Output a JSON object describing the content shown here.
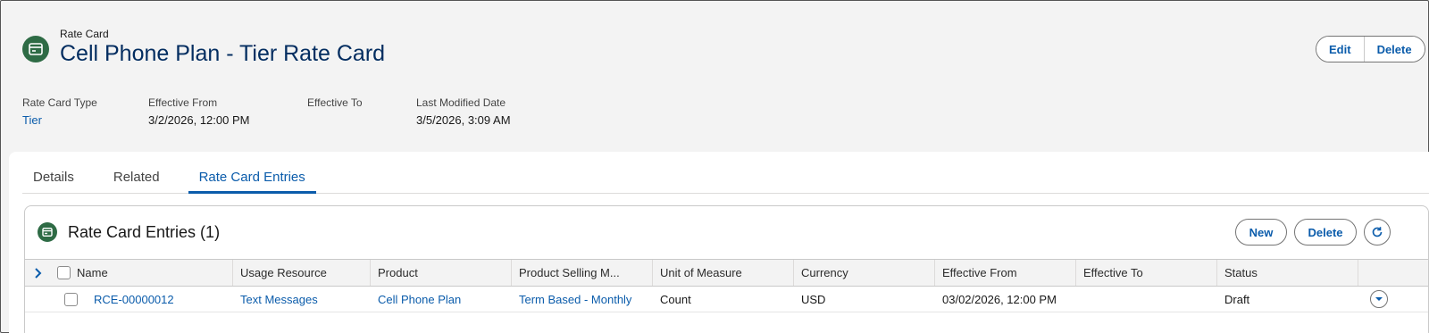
{
  "header": {
    "object_label": "Rate Card",
    "title": "Cell Phone Plan - Tier Rate Card",
    "icon": "rate-card-icon",
    "buttons": {
      "edit": "Edit",
      "delete": "Delete"
    }
  },
  "fields": [
    {
      "label": "Rate Card Type",
      "value": "Tier"
    },
    {
      "label": "Effective From",
      "value": "3/2/2026, 12:00 PM"
    },
    {
      "label": "Effective To",
      "value": ""
    },
    {
      "label": "Last Modified Date",
      "value": "3/5/2026, 3:09 AM"
    }
  ],
  "tabs": [
    {
      "label": "Details",
      "active": false
    },
    {
      "label": "Related",
      "active": false
    },
    {
      "label": "Rate Card Entries",
      "active": true
    }
  ],
  "related_list": {
    "title": "Rate Card Entries (1)",
    "buttons": {
      "new": "New",
      "delete": "Delete",
      "refresh": "refresh-icon"
    },
    "columns": [
      "Name",
      "Usage Resource",
      "Product",
      "Product Selling M...",
      "Unit of Measure",
      "Currency",
      "Effective From",
      "Effective To",
      "Status"
    ],
    "rows": [
      {
        "name": "RCE-00000012",
        "usage_resource": "Text Messages",
        "product": "Cell Phone Plan",
        "selling_model": "Term Based - Monthly",
        "unit": "Count",
        "currency": "USD",
        "effective_from": "03/02/2026, 12:00 PM",
        "effective_to": "",
        "status": "Draft"
      }
    ]
  },
  "colors": {
    "brand": "#0b5cab",
    "icon_bg": "#2e6b45",
    "title": "#032d60"
  }
}
